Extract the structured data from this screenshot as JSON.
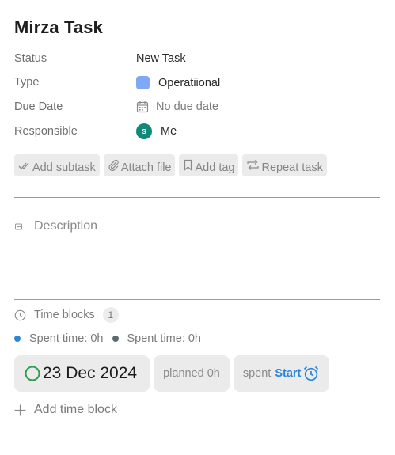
{
  "task": {
    "title": "Mirza Task"
  },
  "properties": {
    "status": {
      "label": "Status",
      "value": "New Task"
    },
    "type": {
      "label": "Type",
      "value": "Operatiional",
      "color": "#7fa9f5"
    },
    "due_date": {
      "label": "Due Date",
      "value": "No due date",
      "icon": "calendar-icon"
    },
    "responsible": {
      "label": "Responsible",
      "value": "Me",
      "avatar_letter": "S",
      "avatar_color": "#0f8a79"
    }
  },
  "actions": {
    "add_subtask": {
      "label": "Add subtask",
      "icon": "checkmark-icon"
    },
    "attach_file": {
      "label": "Attach file",
      "icon": "paperclip-icon"
    },
    "add_tag": {
      "label": "Add tag",
      "icon": "bookmark-icon"
    },
    "repeat_task": {
      "label": "Repeat task",
      "icon": "repeat-icon"
    }
  },
  "description": {
    "label": "Description",
    "icon": "description-icon"
  },
  "time_blocks": {
    "label": "Time blocks",
    "count": "1",
    "icon": "clock-icon",
    "spent_summary": [
      {
        "text": "Spent time: 0h",
        "dot_color": "#2b86d9"
      },
      {
        "text": "Spent time: 0h",
        "dot_color": "#5b6b73"
      }
    ],
    "block": {
      "date": "23 Dec 2024",
      "status_color": "#2e9e4a",
      "planned": "planned 0h",
      "spent": "spent",
      "start_label": "Start",
      "accent_color": "#2b86d9"
    },
    "add_label": "Add time block"
  }
}
